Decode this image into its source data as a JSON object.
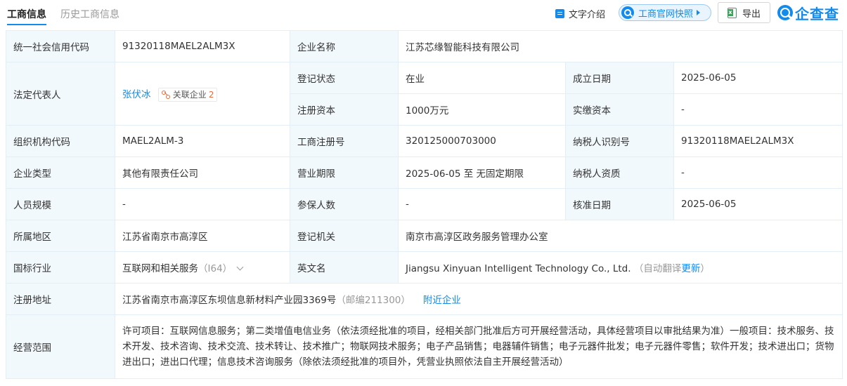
{
  "tabs": {
    "active": "工商信息",
    "history": "历史工商信息"
  },
  "toolbar": {
    "intro_label": "文字介绍",
    "snapshot_label": "工商官网快照",
    "export_label": "导出",
    "logo_text": "企查查",
    "accent_color": "#128bed"
  },
  "rows": {
    "credit_code": {
      "label": "统一社会信用代码",
      "value": "91320118MAEL2ALM3X"
    },
    "company_name": {
      "label": "企业名称",
      "value": "江苏芯缘智能科技有限公司"
    },
    "legal_rep": {
      "label": "法定代表人",
      "name": "张伏冰",
      "related_label": "关联企业",
      "related_count": "2"
    },
    "reg_status": {
      "label": "登记状态",
      "value": "在业"
    },
    "founded": {
      "label": "成立日期",
      "value": "2025-06-05"
    },
    "reg_capital": {
      "label": "注册资本",
      "value": "1000万元"
    },
    "paid_capital": {
      "label": "实缴资本",
      "value": "-"
    },
    "org_code": {
      "label": "组织机构代码",
      "value": "MAEL2ALM-3"
    },
    "biz_reg_no": {
      "label": "工商注册号",
      "value": "320125000703000"
    },
    "taxpayer_id": {
      "label": "纳税人识别号",
      "value": "91320118MAEL2ALM3X"
    },
    "company_type": {
      "label": "企业类型",
      "value": "其他有限责任公司"
    },
    "biz_term": {
      "label": "营业期限",
      "value": "2025-06-05 至 无固定期限"
    },
    "taxpayer_qual": {
      "label": "纳税人资质",
      "value": "-"
    },
    "staff_size": {
      "label": "人员规模",
      "value": "-"
    },
    "insured": {
      "label": "参保人数",
      "value": "-"
    },
    "approval_date": {
      "label": "核准日期",
      "value": "2025-06-05"
    },
    "region": {
      "label": "所属地区",
      "value": "江苏省南京市高淳区"
    },
    "reg_authority": {
      "label": "登记机关",
      "value": "南京市高淳区政务服务管理办公室"
    },
    "industry": {
      "label": "国标行业",
      "value": "互联网和相关服务",
      "code": "（I64）"
    },
    "english_name": {
      "label": "英文名",
      "value": "Jiangsu Xinyuan Intelligent Technology Co., Ltd.",
      "note": "（自动翻译",
      "update_link": "更新",
      "note_end": "）"
    },
    "reg_address": {
      "label": "注册地址",
      "value": "江苏省南京市高淳区东坝信息新材料产业园3369号",
      "postcode": "（邮编211300）",
      "nearby_link": "附近企业"
    },
    "biz_scope": {
      "label": "经营范围",
      "value": "许可项目：互联网信息服务；第二类增值电信业务（依法须经批准的项目，经相关部门批准后方可开展经营活动，具体经营项目以审批结果为准）一般项目：技术服务、技术开发、技术咨询、技术交流、技术转让、技术推广；物联网技术服务；电子产品销售；电器辅件销售；电子元器件批发；电子元器件零售；软件开发；技术进出口；货物进出口；进出口代理；信息技术咨询服务（除依法须经批准的项目外，凭营业执照依法自主开展经营活动）"
    }
  }
}
